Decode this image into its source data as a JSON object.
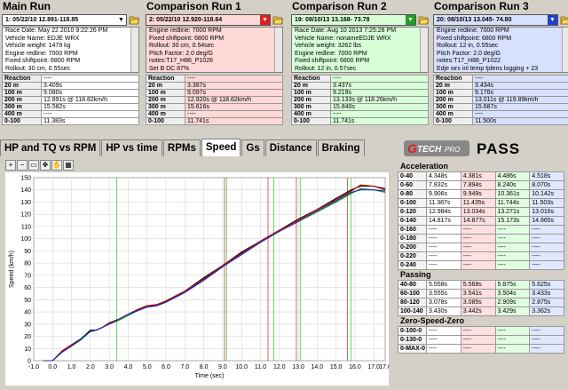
{
  "runs": [
    {
      "title": "Main Run",
      "selector": "1:  05/22/10 12.891-118.85",
      "color": "#ffffff",
      "arrow": "#ffffff",
      "arrowColor": "#000",
      "info": [
        "Race Date: May 22 2010  9:22:26 PM",
        "Vehicle Name: EDJE WRX",
        "Vehicle weight: 1479 kg",
        "Engine redline: 7000 RPM",
        "Fixed shiftpoint: 6800 RPM",
        "Rollout: 30 cm, 0.55sec"
      ],
      "results": [
        [
          "Reaction",
          "----"
        ],
        [
          "20 m",
          "3.409s"
        ],
        [
          "100 m",
          "9.080s"
        ],
        [
          "200 m",
          "12.891s @ 118.82km/h"
        ],
        [
          "300 m",
          "15.582s"
        ],
        [
          "400 m",
          "----"
        ],
        [
          "0-100",
          "11.383s"
        ]
      ]
    },
    {
      "title": "Comparison Run 1",
      "selector": "2:  05/22/10 12.920-118.64",
      "color": "#ffd8d8",
      "arrow": "#e02020",
      "arrowColor": "#fff",
      "info": [
        "Engine redline: 7000 RPM",
        "Fixed shiftpoint: 6800 RPM",
        "Rollout: 30 cm, 0.54sec",
        "Pitch Factor: 2.0 deg/G",
        "notes:T17_H86_P1026",
        "Set B DC 87%"
      ],
      "results": [
        [
          "Reaction",
          "----"
        ],
        [
          "20 m",
          "3.387s"
        ],
        [
          "100 m",
          "9.097s"
        ],
        [
          "200 m",
          "12.920s @ 118.62km/h"
        ],
        [
          "300 m",
          "15.616s"
        ],
        [
          "400 m",
          "----"
        ],
        [
          "0-100",
          "11.741s"
        ]
      ]
    },
    {
      "title": "Comparison Run 2",
      "selector": "19:  08/10/13 13.168- 73.78",
      "color": "#d8ffd8",
      "arrow": "#20a020",
      "arrowColor": "#fff",
      "info": [
        "Race Date: Aug 10 2013  7:25:28 PM",
        "Vehicle Name: nonameEDJE WRX",
        "Vehicle weight: 3262 lbs",
        "Engine redline: 7000 RPM",
        "Fixed shiftpoint: 6800 RPM",
        "Rollout: 12 in, 0.57sec"
      ],
      "results": [
        [
          "Reaction",
          "----"
        ],
        [
          "20 m",
          "3.437s"
        ],
        [
          "100 m",
          "9.219s"
        ],
        [
          "200 m",
          "13.133s @ 118.26km/h"
        ],
        [
          "300 m",
          "15.840s"
        ],
        [
          "400 m",
          "----"
        ],
        [
          "0-100",
          "11.741s"
        ]
      ]
    },
    {
      "title": "Comparison Run 3",
      "selector": "20:  08/10/13 13.045- 74.80",
      "color": "#d8e0ff",
      "arrow": "#2040d0",
      "arrowColor": "#fff",
      "info": [
        "Engine redline: 7000 RPM",
        "Fixed shiftpoint: 6800 RPM",
        "Rollout: 12 in, 0.55sec",
        "Pitch Factor: 2.0 deg/G",
        "notes:T17_H88_P1022",
        "Edje wrx inl temp tjdens logging + 23"
      ],
      "results": [
        [
          "Reaction",
          "----"
        ],
        [
          "20 m",
          "3.434s"
        ],
        [
          "100 m",
          "9.176s"
        ],
        [
          "200 m",
          "13.011s @ 119.89km/h"
        ],
        [
          "300 m",
          "15.687s"
        ],
        [
          "400 m",
          "----"
        ],
        [
          "0-100",
          "11.500s"
        ]
      ]
    }
  ],
  "tabs": [
    "HP and TQ vs RPM",
    "HP vs time",
    "RPMs",
    "Speed",
    "Gs",
    "Distance",
    "Braking"
  ],
  "activeTab": "Speed",
  "logo": {
    "g": "G",
    "tech": "TECH",
    "pro": "PRO",
    "pass": "PASS"
  },
  "tools": [
    "zoom-in",
    "zoom-out",
    "zoom-box",
    "pan",
    "hand",
    "grid"
  ],
  "toolGlyphs": [
    "+",
    "−",
    "▭",
    "✥",
    "✋",
    "▦"
  ],
  "chart_data": {
    "type": "line",
    "xlabel": "Time (sec)",
    "ylabel": "Speed (km/h)",
    "xlim": [
      -1.0,
      17.6
    ],
    "ylim": [
      0,
      150
    ],
    "xticks": [
      "-1.0",
      "0.0",
      "1.0",
      "2.0",
      "3.0",
      "4.0",
      "5.0",
      "6.0",
      "7.0",
      "8.0",
      "9.0",
      "10.0",
      "11.0",
      "12.0",
      "13.0",
      "14.0",
      "15.0",
      "16.0",
      "17.0",
      "17.6"
    ],
    "yticks": [
      "0",
      "10",
      "20",
      "30",
      "40",
      "50",
      "60",
      "70",
      "80",
      "90",
      "100",
      "110",
      "120",
      "130",
      "140",
      "150"
    ],
    "series": [
      {
        "color": "#000000",
        "x": [
          -0.5,
          0,
          0.5,
          1,
          1.5,
          2,
          2.3,
          2.6,
          3,
          3.5,
          4,
          4.5,
          5,
          5.5,
          6,
          6.5,
          7,
          8,
          9,
          10,
          11,
          12,
          13,
          14,
          15,
          15.8,
          16.3,
          17,
          17.6
        ],
        "y": [
          0,
          0,
          8,
          13,
          18,
          25,
          25,
          27,
          31,
          34,
          38,
          42,
          45,
          45,
          49,
          53,
          57,
          68,
          78,
          89,
          98,
          107,
          116,
          124,
          133,
          140,
          143,
          143,
          141
        ]
      },
      {
        "color": "#c00000",
        "x": [
          -0.5,
          0,
          0.5,
          1,
          1.5,
          2,
          2.3,
          2.6,
          3,
          3.5,
          4,
          4.5,
          5,
          5.5,
          6,
          6.5,
          7,
          8,
          9,
          10,
          11,
          12,
          13,
          14,
          15,
          15.8,
          16.3,
          17,
          17.6
        ],
        "y": [
          0,
          0,
          8,
          13,
          18,
          24,
          25,
          27,
          31,
          34,
          38,
          42,
          45,
          46,
          49,
          53,
          57,
          67,
          78,
          88,
          98,
          107,
          115,
          124,
          132,
          139,
          144,
          143,
          140
        ]
      },
      {
        "color": "#00a000",
        "x": [
          -0.5,
          0,
          0.5,
          1,
          1.5,
          2,
          2.3,
          2.6,
          3,
          3.5,
          4,
          4.5,
          5,
          5.5,
          6,
          6.5,
          7,
          8,
          9,
          10,
          11,
          12,
          13,
          14,
          15,
          15.8,
          16.3,
          17,
          17.6
        ],
        "y": [
          0,
          0,
          7,
          12,
          17,
          24,
          25,
          27,
          30,
          33,
          37,
          41,
          44,
          45,
          48,
          52,
          56,
          66,
          77,
          87,
          97,
          106,
          114,
          122,
          130,
          137,
          141,
          140,
          138
        ]
      },
      {
        "color": "#2020c0",
        "x": [
          -0.5,
          0,
          0.5,
          1,
          1.5,
          2,
          2.3,
          2.6,
          3,
          3.5,
          4,
          4.5,
          5,
          5.5,
          6,
          6.5,
          7,
          8,
          9,
          10,
          11,
          12,
          13,
          14,
          15,
          15.8,
          16.3,
          17,
          17.6
        ],
        "y": [
          0,
          0,
          7,
          12,
          18,
          24,
          25,
          27,
          30,
          34,
          38,
          41,
          44,
          45,
          48,
          52,
          56,
          66,
          77,
          87,
          97,
          106,
          114,
          123,
          131,
          138,
          140,
          140,
          139
        ]
      }
    ],
    "markers": [
      {
        "x": 3.4,
        "color": "#00c000"
      },
      {
        "x": 9.1,
        "color": "#c00000"
      },
      {
        "x": 9.2,
        "color": "#00c000"
      },
      {
        "x": 11.4,
        "color": "#c00000"
      },
      {
        "x": 11.7,
        "color": "#00c000"
      },
      {
        "x": 12.9,
        "color": "#c00000"
      },
      {
        "x": 13.1,
        "color": "#00c000"
      },
      {
        "x": 15.6,
        "color": "#c00000"
      },
      {
        "x": 15.8,
        "color": "#00c000"
      }
    ]
  },
  "acceleration": {
    "title": "Acceleration",
    "rows": [
      [
        "0-40",
        "4.348s",
        "4.381s",
        "4.486s",
        "4.518s"
      ],
      [
        "0-60",
        "7.832s",
        "7.894s",
        "8.240s",
        "8.070s"
      ],
      [
        "0-80",
        "9.906s",
        "9.949s",
        "10.361s",
        "10.142s"
      ],
      [
        "0-100",
        "11.387s",
        "11.435s",
        "11.744s",
        "11.503s"
      ],
      [
        "0-120",
        "12.984s",
        "13.034s",
        "13.271s",
        "13.016s"
      ],
      [
        "0-140",
        "14.817s",
        "14.877s",
        "15.173s",
        "14.865s"
      ],
      [
        "0-160",
        "----",
        "----",
        "----",
        "----"
      ],
      [
        "0-180",
        "----",
        "----",
        "----",
        "----"
      ],
      [
        "0-200",
        "----",
        "----",
        "----",
        "----"
      ],
      [
        "0-220",
        "----",
        "----",
        "----",
        "----"
      ],
      [
        "0-240",
        "----",
        "----",
        "----",
        "----"
      ]
    ]
  },
  "passing": {
    "title": "Passing",
    "rows": [
      [
        "40-80",
        "5.558s",
        "5.568s",
        "5.875s",
        "5.625s"
      ],
      [
        "60-100",
        "3.555s",
        "3.541s",
        "3.504s",
        "3.433s"
      ],
      [
        "80-120",
        "3.078s",
        "3.085s",
        "2.909s",
        "2.875s"
      ],
      [
        "100-140",
        "3.430s",
        "3.442s",
        "3.429s",
        "3.362s"
      ]
    ]
  },
  "zero": {
    "title": "Zero-Speed-Zero",
    "rows": [
      [
        "0-100-0",
        "----",
        "----",
        "----",
        "----"
      ],
      [
        "0-130-0",
        "----",
        "----",
        "----",
        "----"
      ],
      [
        "0-MAX-0",
        "----",
        "----",
        "----",
        "----"
      ]
    ]
  }
}
